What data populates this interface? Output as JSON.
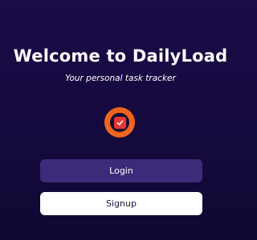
{
  "welcome": {
    "title": "Welcome to DailyLoad",
    "subtitle": "Your personal task tracker"
  },
  "logo": {
    "icon": "check-icon",
    "ring_color": "#f0641e",
    "check_color": "#e53535"
  },
  "actions": {
    "login_label": "Login",
    "signup_label": "Signup"
  },
  "colors": {
    "background": "#1b0b48",
    "login_button": "#3d2a78",
    "signup_button": "#ffffff"
  }
}
